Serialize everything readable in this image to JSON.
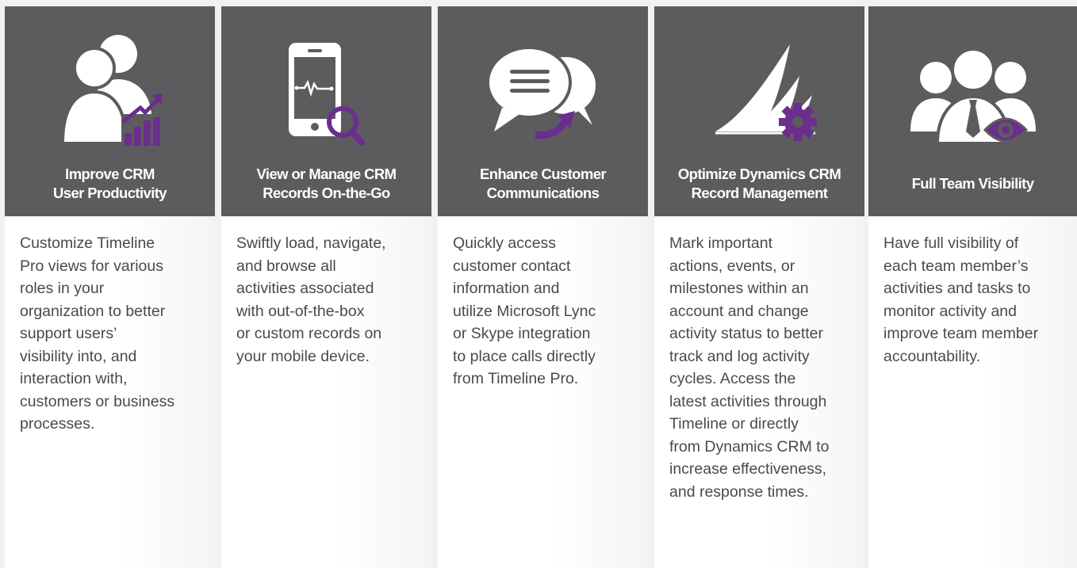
{
  "colors": {
    "header_bg": "#5c5c5e",
    "accent_purple": "#6b2d8e",
    "text": "#4a4a4c"
  },
  "cards": [
    {
      "icon": "users-growth-chart-icon",
      "title": [
        "Improve CRM",
        "User Productivity"
      ],
      "lines": [
        "Customize Timeline",
        "Pro views for various",
        "roles in your",
        "organization to better",
        "support users’",
        "visibility into, and",
        "interaction with,",
        "customers or business",
        "processes."
      ]
    },
    {
      "icon": "mobile-search-icon",
      "title": [
        "View or Manage CRM",
        "Records On-the-Go"
      ],
      "lines": [
        "Swiftly load, navigate,",
        "and browse all",
        "activities associated",
        "with out-of-the-box",
        "or custom records on",
        "your mobile device."
      ]
    },
    {
      "icon": "chat-bubbles-icon",
      "title": [
        "Enhance Customer",
        "Communications"
      ],
      "lines": [
        "Quickly access",
        "customer contact",
        "information and",
        "utilize Microsoft Lync",
        "or Skype integration",
        "to place calls directly",
        "from Timeline Pro."
      ]
    },
    {
      "icon": "dynamics-sail-gear-icon",
      "title": [
        "Optimize Dynamics CRM",
        "Record Management"
      ],
      "lines": [
        "Mark important",
        "actions, events, or",
        "milestones within an",
        "account and change",
        "activity status to better",
        "track and log activity",
        "cycles. Access the",
        "latest activities through",
        "Timeline or directly",
        "from Dynamics CRM to",
        "increase effectiveness,",
        "and response times."
      ]
    },
    {
      "icon": "team-eye-icon",
      "title": [
        "Full Team Visibility"
      ],
      "lines": [
        "Have full visibility of",
        "each team member’s",
        "activities and tasks to",
        "monitor activity and",
        "improve team member",
        "accountability."
      ]
    }
  ]
}
